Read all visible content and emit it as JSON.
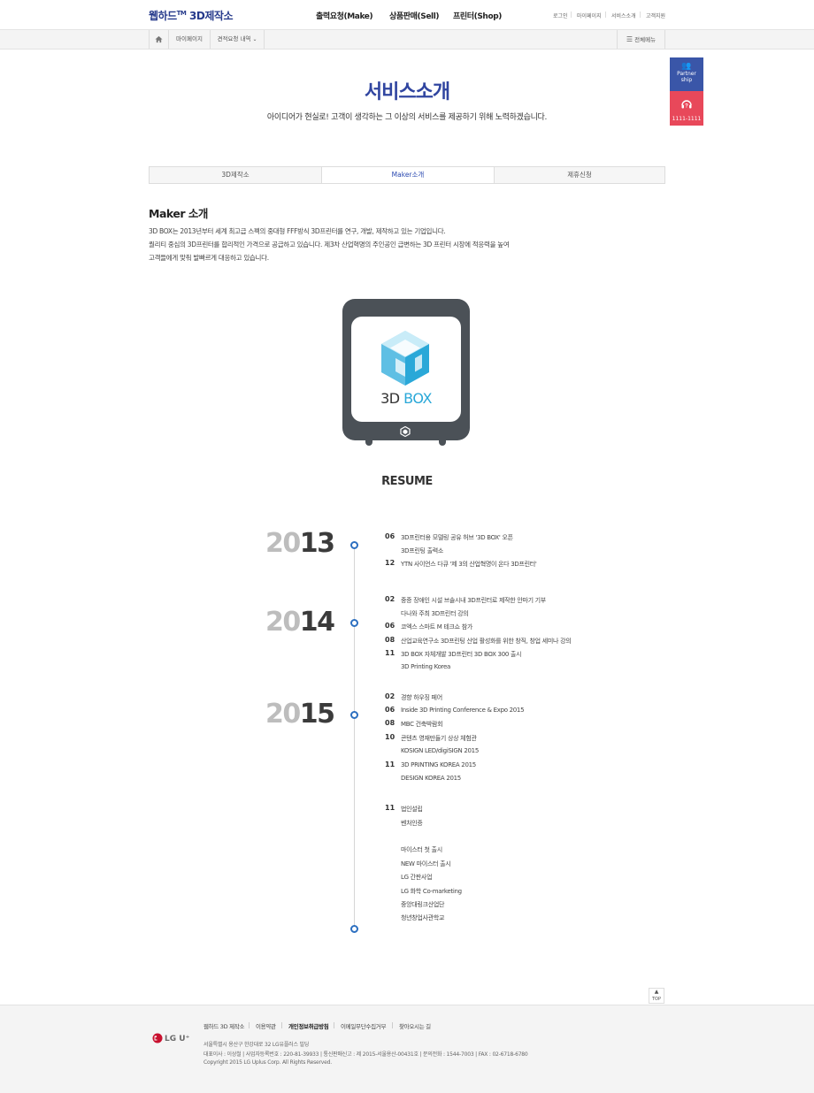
{
  "header": {
    "logo_main": "웹하드",
    "logo_tm": "TM",
    "logo_sub": " 3D제작소",
    "nav": [
      "출력요청(Make)",
      "상품판매(Sell)",
      "프린터(Shop)"
    ],
    "util": [
      "로그인",
      "마이페이지",
      "서비스소개",
      "고객지원"
    ]
  },
  "location": {
    "items": [
      "마이페이지",
      "견적요청 내역"
    ],
    "all_menu": "전체메뉴"
  },
  "quick": {
    "partner": "Partner ship",
    "call": "1111-1111"
  },
  "page": {
    "title": "서비스소개",
    "subtitle": "아이디어가 현실로! 고객이 생각하는 그 이상의 서비스를 제공하기 위해 노력하겠습니다."
  },
  "tabs": [
    "3D제작소",
    "Maker소개",
    "제휴신청"
  ],
  "maker": {
    "title": "Maker 소개",
    "desc": [
      "3D BOX는 2013년부터 세계 최고급 스펙의 중대형 FFF방식 3D프린터를 연구, 개발, 제작하고 있는 기업입니다.",
      "퀄리티 중심의 3D프린터를 합리적인 가격으로 공급하고 있습니다. 제3차 산업혁명의 주인공인 급변하는 3D 프린터 시장에 적응력을 높여",
      "고객들에게 맞춰 발빠르게 대응하고 있습니다."
    ],
    "brand_3d": "3D",
    "brand_box": "BOX"
  },
  "resume": {
    "title": "RESUME",
    "years": [
      {
        "light": "20",
        "dark": "13"
      },
      {
        "light": "20",
        "dark": "14"
      },
      {
        "light": "20",
        "dark": "15"
      }
    ],
    "entries": [
      {
        "month": "06",
        "text": "3D프린터용 모델링 공유 허브 '3D BOX' 오픈"
      },
      {
        "month": "",
        "text": "3D프린팅 출력소"
      },
      {
        "month": "12",
        "text": "YTN 사이언스 다큐 '제 3의 산업혁명이 온다 3D프린터'"
      },
      {
        "month": "02",
        "text": "중증 장애인 시설 브솔시내 3D프린터로 제작한 안마기 기부"
      },
      {
        "month": "",
        "text": "다나와 주최 3D프린터 강의"
      },
      {
        "month": "06",
        "text": "코엑스 스마트 M 테크쇼 참가"
      },
      {
        "month": "08",
        "text": "산업교육연구소 3D프린팅 산업 활성화를 위한 창직, 창업 세미나 강의"
      },
      {
        "month": "11",
        "text": "3D BOX 자체개발 3D프린터 3D BOX 300 출시"
      },
      {
        "month": "",
        "text": "3D Printing Korea"
      },
      {
        "month": "02",
        "text": "경향 하우징 페어"
      },
      {
        "month": "06",
        "text": "Inside 3D Printing Conference & Expo 2015"
      },
      {
        "month": "08",
        "text": "MBC 건축박람회"
      },
      {
        "month": "10",
        "text": "콘텐츠 영재만들기 상상 체험관"
      },
      {
        "month": "",
        "text": "KOSIGN LED/digiSIGN 2015"
      },
      {
        "month": "11",
        "text": "3D PRINTING KOREA 2015"
      },
      {
        "month": "",
        "text": "DESIGN KOREA 2015"
      },
      {
        "month": "11",
        "text": "법인설립"
      },
      {
        "month": "",
        "text": "벤처인증"
      },
      {
        "month": "",
        "text": "마이스터 첫 출시"
      },
      {
        "month": "",
        "text": "NEW 마이스터 출시"
      },
      {
        "month": "",
        "text": "LG 간판사업"
      },
      {
        "month": "",
        "text": "LG 화학 Co-marketing"
      },
      {
        "month": "",
        "text": "중앙대링크산업단"
      },
      {
        "month": "",
        "text": "청년창업사관학교"
      }
    ]
  },
  "top_button": "TOP",
  "footer": {
    "links": [
      "웹하드 3D 제작소",
      "이용약관",
      "개인정보취급방침",
      "이메일무단수집거부",
      "찾아오시는 길"
    ],
    "logo": "LG U⁺",
    "address": "서울특별시 용산구 한강대로 32 LG유플러스 빌딩",
    "info": "대표이사 : 이상철   |   사업자등록번호 : 220-81-39933   |   통신판매신고 : 제 2015-서울용산-00431호   |   문의전화 : 1544-7003   |   FAX : 02-6718-6780",
    "copyright": "Copyright 2015 LG Uplus Corp. All Rights Reserved."
  }
}
